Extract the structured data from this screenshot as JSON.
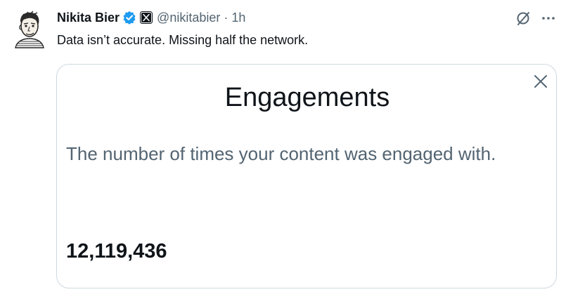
{
  "tweet": {
    "display_name": "Nikita Bier",
    "handle": "@nikitabier",
    "separator": "·",
    "time": "1h",
    "text": "Data isn’t accurate. Missing half the network.",
    "icons": {
      "verified": "verified-badge-icon",
      "affiliate": "x-logo-icon",
      "grok": "grok-icon",
      "more": "more-options-icon"
    }
  },
  "card": {
    "title": "Engagements",
    "description": "The number of times your content was engaged with.",
    "value": "12,119,436",
    "close_icon": "close-icon"
  },
  "colors": {
    "text_primary": "#0f1419",
    "text_secondary": "#536471",
    "verified_blue": "#1d9bf0",
    "border": "#cfd9de"
  }
}
